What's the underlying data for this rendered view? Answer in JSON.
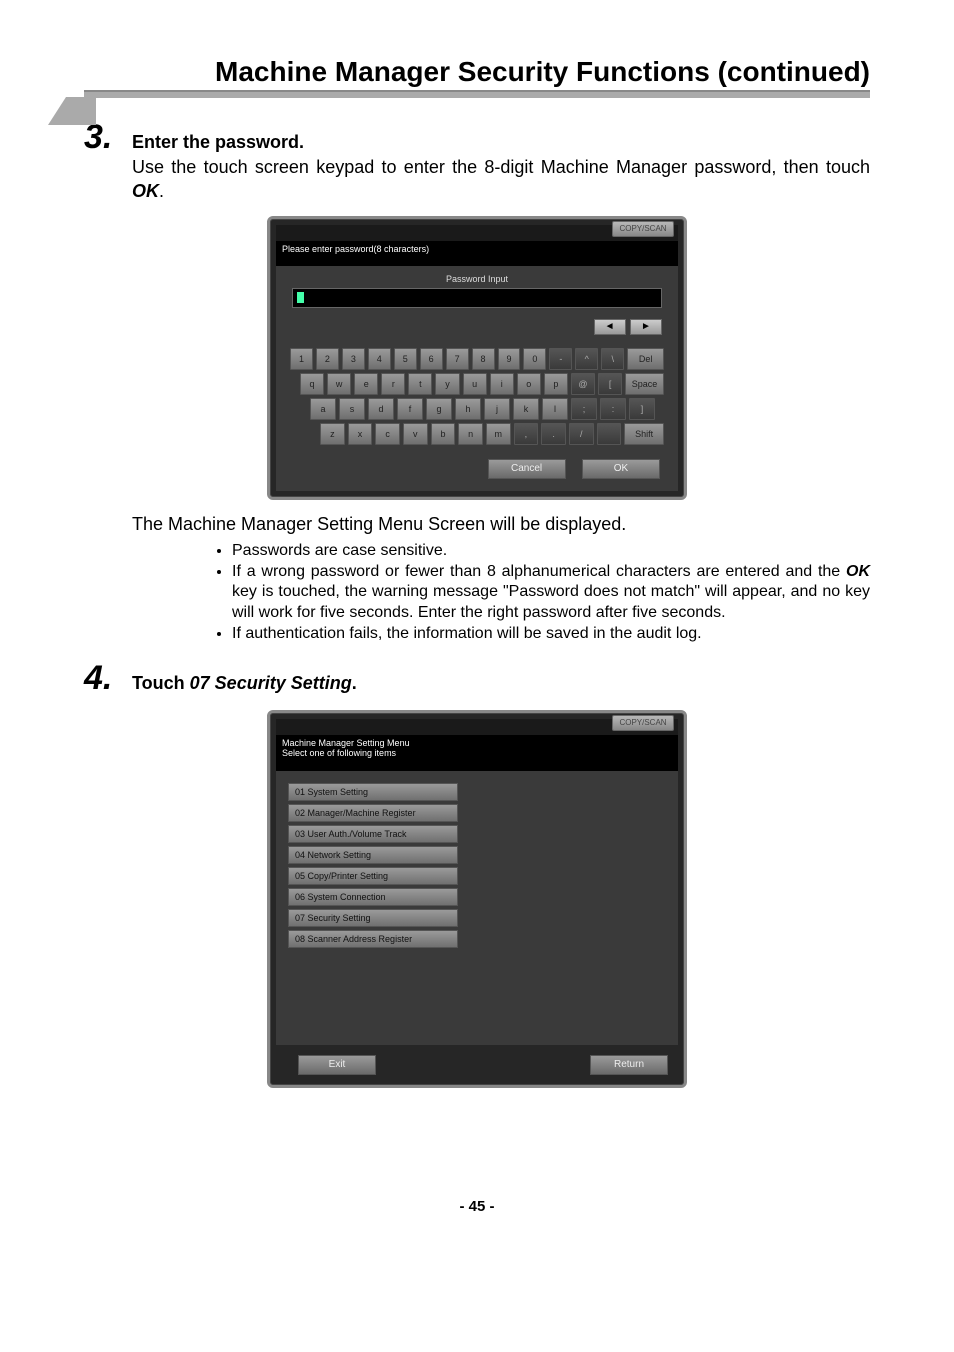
{
  "header": {
    "title": "Machine Manager Security Functions (continued)"
  },
  "step3": {
    "number": "3.",
    "heading": "Enter the password.",
    "text_before": "Use the touch screen keypad to enter the 8-digit Machine Manager password, then touch ",
    "ok": "OK",
    "text_after": ".",
    "after_img": "The Machine Manager Setting Menu Screen will be displayed.",
    "bullet1": "Passwords are case sensitive.",
    "bullet2_a": "If a wrong password or fewer than 8 alphanumerical characters are entered and the ",
    "bullet2_ok": "OK",
    "bullet2_b": " key is touched, the warning message \"Password does not match\" will appear, and no key will work for five seconds. Enter the right password after five seconds.",
    "bullet3": "If authentication fails, the information will be saved in the audit log."
  },
  "step4": {
    "number": "4.",
    "heading_a": "Touch ",
    "heading_b": "07 Security Setting",
    "heading_c": "."
  },
  "screenshot1": {
    "corner": "COPY/SCAN",
    "message": "Please enter password(8 characters)",
    "panel_title": "Password Input",
    "arrow_left": "◄",
    "arrow_right": "►",
    "keys": {
      "row1": [
        "1",
        "2",
        "3",
        "4",
        "5",
        "6",
        "7",
        "8",
        "9",
        "0",
        "-",
        "^",
        "\\",
        "Del"
      ],
      "row2": [
        "q",
        "w",
        "e",
        "r",
        "t",
        "y",
        "u",
        "i",
        "o",
        "p",
        "@",
        "[",
        "Space"
      ],
      "row3": [
        "a",
        "s",
        "d",
        "f",
        "g",
        "h",
        "j",
        "k",
        "l",
        ";",
        ":",
        "]"
      ],
      "row4": [
        "z",
        "x",
        "c",
        "v",
        "b",
        "n",
        "m",
        ",",
        ".",
        "/",
        "",
        "Shift"
      ]
    },
    "cancel": "Cancel",
    "ok": "OK"
  },
  "screenshot2": {
    "corner": "COPY/SCAN",
    "msg_line1": "Machine Manager Setting Menu",
    "msg_line2": "Select one of following items",
    "items": [
      "01 System Setting",
      "02 Manager/Machine Register",
      "03 User Auth./Volume Track",
      "04 Network Setting",
      "05 Copy/Printer Setting",
      "06 System Connection",
      "07 Security Setting",
      "08 Scanner Address Register"
    ],
    "exit": "Exit",
    "return": "Return"
  },
  "page_number": "- 45 -"
}
